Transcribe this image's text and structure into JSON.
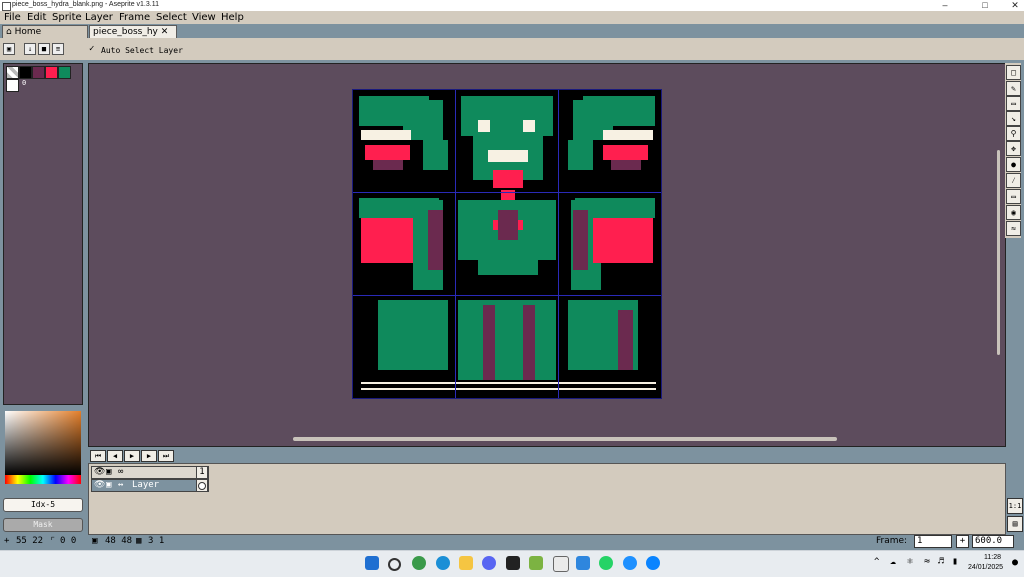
{
  "window": {
    "title": "piece_boss_hydra_blank.png - Aseprite v1.3.11",
    "min_glyph": "–",
    "max_glyph": "□",
    "close_glyph": "✕"
  },
  "menu": [
    "File",
    "Edit",
    "Sprite",
    "Layer",
    "Frame",
    "Select",
    "View",
    "Help"
  ],
  "tabs": {
    "home": "Home",
    "file": "piece_boss_hy",
    "close": "✕"
  },
  "toolbar": {
    "auto_select": "Auto Select Layer"
  },
  "palette": {
    "colors": [
      "#000000",
      "#6b2a4f",
      "#ff1f4f",
      "#0f8a5c"
    ],
    "index_label": "0",
    "fg_index": "Idx-5",
    "mask_label": "Mask"
  },
  "timeline": {
    "frame_header": "1",
    "layer_name": "Layer"
  },
  "status": {
    "cursor": "55 22",
    "selection": "0 0",
    "size": "48 48",
    "grid": "3 1",
    "frame_label": "Frame:",
    "frame_value": "1",
    "zoom": "600.0",
    "one_to_one": "1:1"
  },
  "taskbar": {
    "time": "11:28",
    "date": "24/01/2025"
  },
  "sprite_colors": {
    "bg": "#000000",
    "green": "#0f8a5c",
    "red": "#ff1f4f",
    "plum": "#6b2a4f",
    "cream": "#f7f1e3",
    "grid": "#2a2ab8"
  }
}
